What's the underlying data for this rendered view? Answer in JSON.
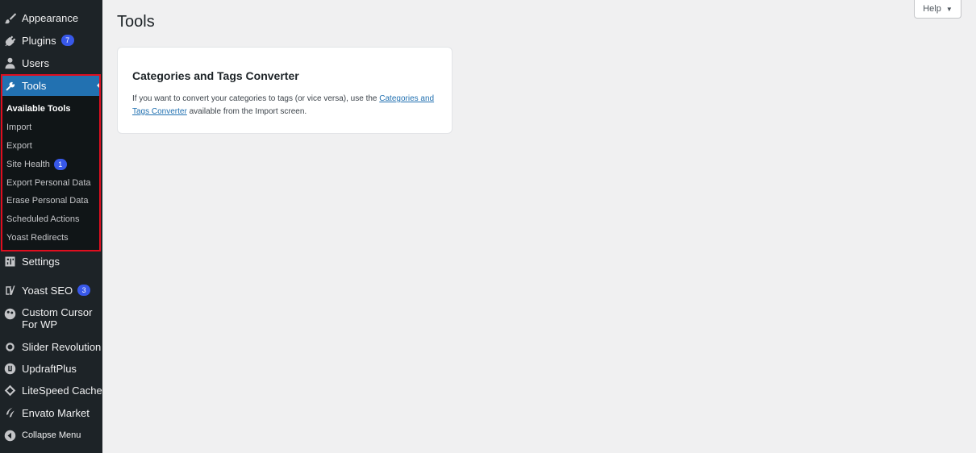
{
  "sidebar": {
    "top_items": [
      {
        "label": "Appearance",
        "icon": "paintbrush-icon"
      },
      {
        "label": "Plugins",
        "icon": "plugin-icon",
        "badge": "7"
      },
      {
        "label": "Users",
        "icon": "user-icon"
      }
    ],
    "active": {
      "label": "Tools",
      "icon": "wrench-icon"
    },
    "submenu": [
      {
        "label": "Available Tools",
        "current": true
      },
      {
        "label": "Import"
      },
      {
        "label": "Export"
      },
      {
        "label": "Site Health",
        "badge": "1"
      },
      {
        "label": "Export Personal Data"
      },
      {
        "label": "Erase Personal Data"
      },
      {
        "label": "Scheduled Actions"
      },
      {
        "label": "Yoast Redirects"
      }
    ],
    "bottom_items": [
      {
        "label": "Settings",
        "icon": "settings-icon"
      },
      {
        "label": "Yoast SEO",
        "icon": "yoast-icon",
        "badge": "3"
      },
      {
        "label": "Custom Cursor For WP",
        "icon": "cursor-icon"
      },
      {
        "label": "Slider Revolution",
        "icon": "slider-revolution-icon"
      },
      {
        "label": "UpdraftPlus",
        "icon": "updraftplus-icon"
      },
      {
        "label": "LiteSpeed Cache",
        "icon": "litespeed-icon"
      },
      {
        "label": "Envato Market",
        "icon": "envato-icon"
      },
      {
        "label": "Collapse Menu",
        "icon": "collapse-icon"
      }
    ]
  },
  "page": {
    "title": "Tools",
    "help_label": "Help",
    "help_caret": "▼"
  },
  "card": {
    "title": "Categories and Tags Converter",
    "text_before": "If you want to convert your categories to tags (or vice versa), use the ",
    "link_text": "Categories and Tags Converter",
    "text_after": " available from the Import screen."
  },
  "colors": {
    "sidebar_bg": "#1d2327",
    "active_bg": "#2271b1",
    "badge_bg": "#3858e9",
    "highlight_border": "#e00e1f",
    "link": "#2271b1"
  }
}
